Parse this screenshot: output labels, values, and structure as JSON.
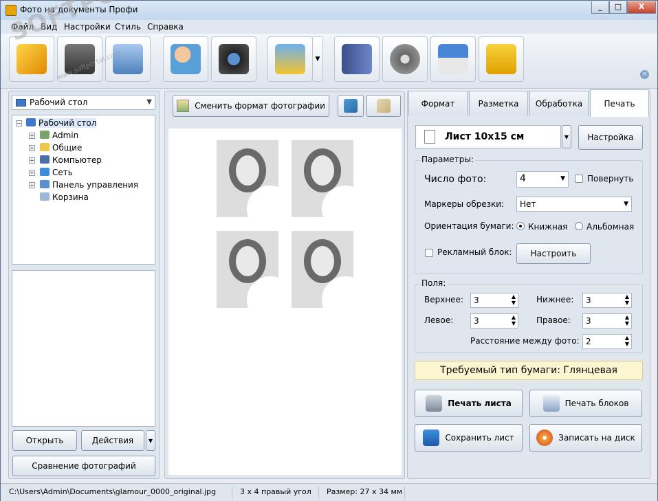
{
  "window": {
    "title": "Фото на документы Профи",
    "min": "_",
    "max": "□",
    "close": "X"
  },
  "menu": [
    "Файл",
    "Вид",
    "Настройки",
    "Стиль",
    "Справка"
  ],
  "watermark": {
    "main": "SOFTPORTAL",
    "sub": "www.softportal.com"
  },
  "toolbar": {
    "close": "×"
  },
  "left": {
    "folder_combo": "Рабочий стол",
    "tree": [
      {
        "label": "Рабочий стол",
        "sign": "−"
      },
      {
        "label": "Admin",
        "sign": "+"
      },
      {
        "label": "Общие",
        "sign": "+"
      },
      {
        "label": "Компьютер",
        "sign": "+"
      },
      {
        "label": "Сеть",
        "sign": "+"
      },
      {
        "label": "Панель управления",
        "sign": "+"
      },
      {
        "label": "Корзина",
        "sign": ""
      }
    ],
    "open_button": "Открыть",
    "actions_button": "Действия",
    "compare_button": "Сравнение фотографий"
  },
  "center": {
    "change_format_button": "Сменить формат фотографии"
  },
  "tabs": [
    "Формат",
    "Разметка",
    "Обработка",
    "Печать"
  ],
  "right": {
    "sheet_label": "Лист 10х15 см",
    "setup_button": "Настройка",
    "params_legend": "Параметры:",
    "photo_count_label": "Число фото:",
    "photo_count_value": "4",
    "rotate_label": "Повернуть",
    "crop_markers_label": "Маркеры обрезки:",
    "crop_markers_value": "Нет",
    "orientation_label": "Ориентация бумаги:",
    "portrait_label": "Книжная",
    "landscape_label": "Альбомная",
    "ad_block_label": "Рекламный блок:",
    "configure_button": "Настроить",
    "margins_legend": "Поля:",
    "top_label": "Верхнее:",
    "top_value": "3",
    "bottom_label": "Нижнее:",
    "bottom_value": "3",
    "left_label": "Левое:",
    "left_value": "3",
    "right_label": "Правое:",
    "right_value": "3",
    "spacing_label": "Расстояние между фото:",
    "spacing_value": "2",
    "paper_type_banner": "Требуемый тип бумаги: Глянцевая",
    "print_sheet_button": "Печать листа",
    "print_blocks_button": "Печать блоков",
    "save_sheet_button": "Сохранить лист",
    "burn_disc_button": "Записать на диск"
  },
  "status": {
    "path": "C:\\Users\\Admin\\Documents\\glamour_0000_original.jpg",
    "format": "3 х 4 правый угол",
    "size": "Размер: 27 x 34 мм"
  },
  "colors": {
    "accent": "#4f81bd",
    "banner": "#fbf6cf"
  }
}
